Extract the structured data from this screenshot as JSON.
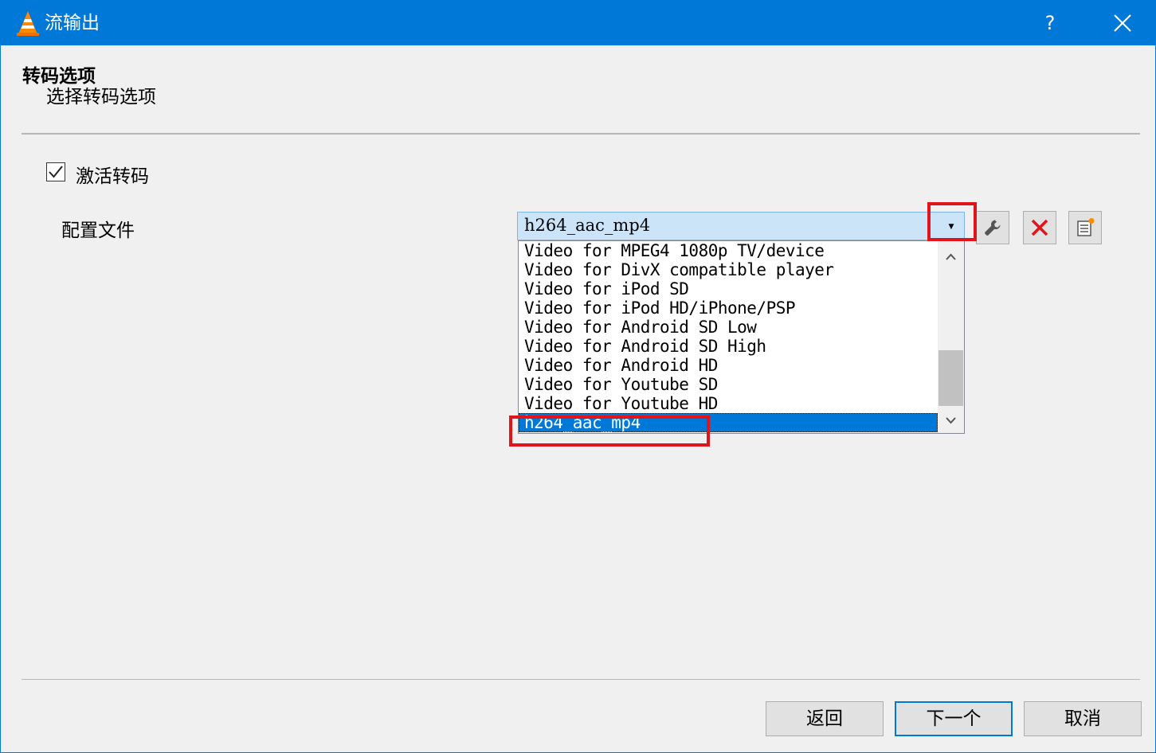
{
  "window": {
    "title": "流输出",
    "help_label": "?",
    "title_bar_color": "#0078d7"
  },
  "section": {
    "title": "转码选项",
    "subtitle": "选择转码选项"
  },
  "transcode": {
    "checkbox_label": "激活转码",
    "checked": true
  },
  "profile": {
    "label": "配置文件",
    "selected": "h264_aac_mp4",
    "options": [
      "Video for MPEG4 1080p TV/device",
      "Video for DivX compatible player",
      "Video for iPod SD",
      "Video for iPod HD/iPhone/PSP",
      "Video for Android SD Low",
      "Video for Android SD High",
      "Video for Android HD",
      "Video for Youtube SD",
      "Video for Youtube HD",
      "h264_aac_mp4"
    ],
    "tool_icons": [
      "wrench-icon",
      "delete-x-icon",
      "new-profile-icon"
    ]
  },
  "annotation_color": "#e0151c",
  "buttons": {
    "back": "返回",
    "next": "下一个",
    "cancel": "取消"
  }
}
